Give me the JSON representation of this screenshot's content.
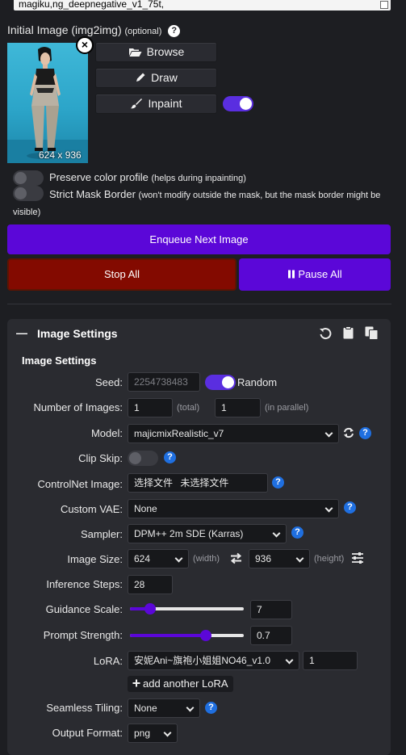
{
  "prompt": {
    "text": "magiku,ng_deepnegative_v1_75t,"
  },
  "initial_image": {
    "label": "Initial Image (img2img)",
    "optional": "(optional)",
    "help": "?",
    "size_text": "624 x 936",
    "close": "×",
    "buttons": {
      "browse": "Browse",
      "draw": "Draw",
      "inpaint": "Inpaint"
    }
  },
  "options": {
    "preserve_color": {
      "label": "Preserve color profile",
      "note": "(helps during inpainting)"
    },
    "strict_mask": {
      "label": "Strict Mask Border",
      "note": "(won't modify outside the mask, but the mask border might be visible)"
    }
  },
  "actions": {
    "enqueue": "Enqueue Next Image",
    "stop_all": "Stop All",
    "pause_all": "Pause All"
  },
  "panel": {
    "title": "Image Settings",
    "subtitle": "Image Settings",
    "collapse": "—"
  },
  "settings": {
    "seed": {
      "label": "Seed:",
      "value": "2254738483",
      "random_label": "Random"
    },
    "num_images": {
      "label": "Number of Images:",
      "total": "1",
      "total_note": "(total)",
      "parallel": "1",
      "parallel_note": "(in parallel)"
    },
    "model": {
      "label": "Model:",
      "value": "majicmixRealistic_v7"
    },
    "clip_skip": {
      "label": "Clip Skip:"
    },
    "controlnet": {
      "label": "ControlNet Image:",
      "choose": "选择文件",
      "none": "未选择文件"
    },
    "vae": {
      "label": "Custom VAE:",
      "value": "None"
    },
    "sampler": {
      "label": "Sampler:",
      "value": "DPM++ 2m SDE (Karras)"
    },
    "image_size": {
      "label": "Image Size:",
      "width": "624",
      "width_note": "(width)",
      "height": "936",
      "height_note": "(height)"
    },
    "steps": {
      "label": "Inference Steps:",
      "value": "28"
    },
    "guidance": {
      "label": "Guidance Scale:",
      "value": "7",
      "fraction": 0.18
    },
    "prompt_strength": {
      "label": "Prompt Strength:",
      "value": "0.7",
      "fraction": 0.67
    },
    "lora": {
      "label": "LoRA:",
      "value": "安妮Ani~旗袍小姐姐NO46_v1.0",
      "weight": "1",
      "add": "add another LoRA"
    },
    "tiling": {
      "label": "Seamless Tiling:",
      "value": "None"
    },
    "output_format": {
      "label": "Output Format:",
      "value": "png"
    }
  },
  "colors": {
    "accent": "#5b07d8",
    "stop": "#830a00",
    "help": "#1f6fe0"
  }
}
